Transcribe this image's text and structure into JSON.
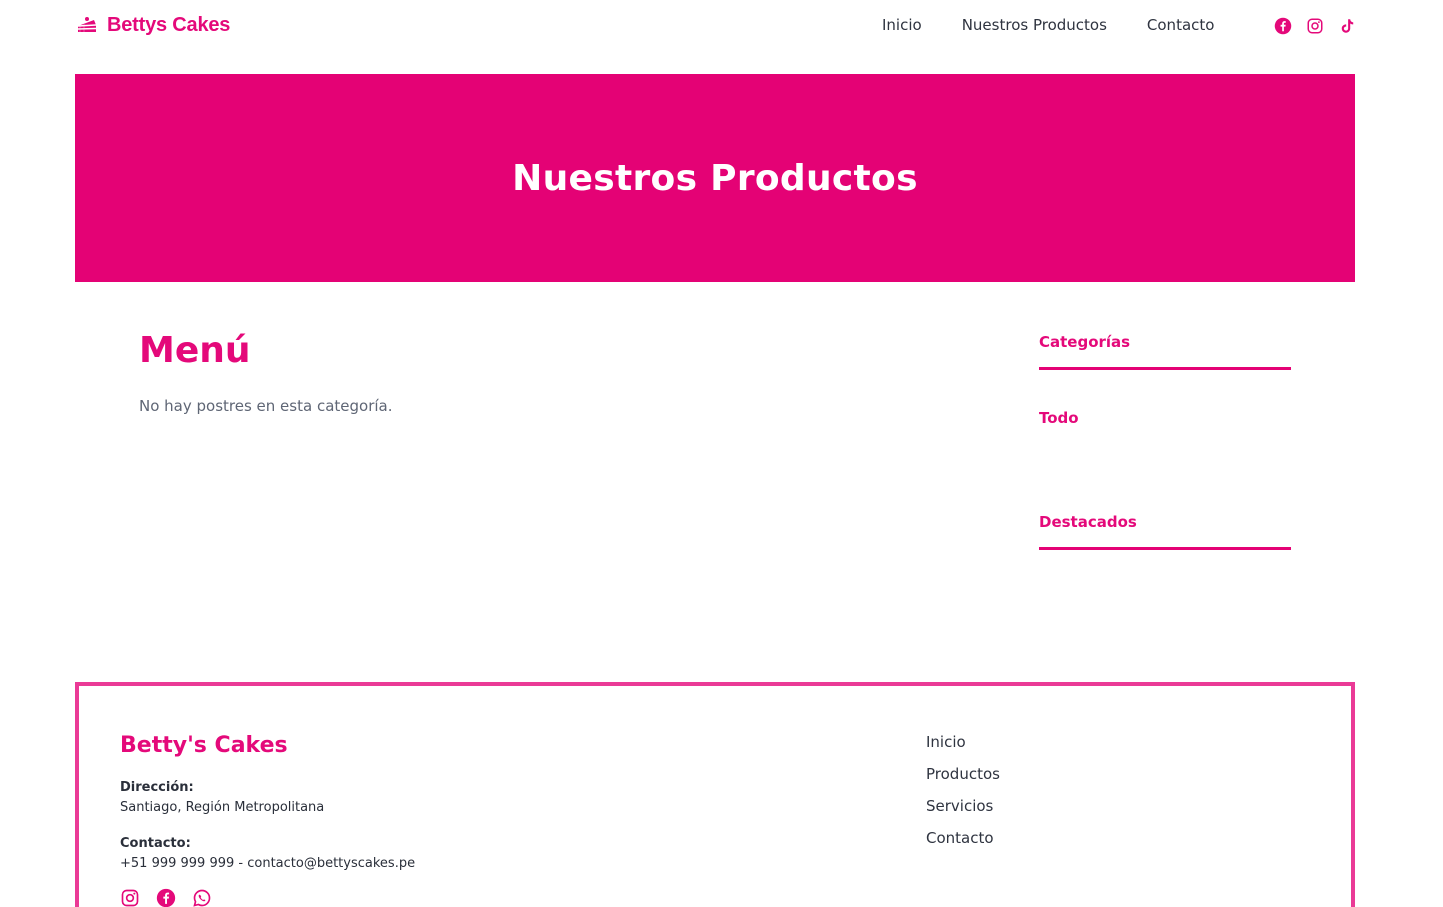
{
  "header": {
    "brand": "Bettys Cakes",
    "nav": [
      "Inicio",
      "Nuestros Productos",
      "Contacto"
    ],
    "social_icons": [
      "facebook-icon",
      "instagram-icon",
      "tiktok-icon"
    ]
  },
  "hero": {
    "title": "Nuestros Productos"
  },
  "main": {
    "heading": "Menú",
    "empty_message": "No hay postres en esta categoría."
  },
  "sidebar": {
    "categories_title": "Categorías",
    "categories": [
      "Todo"
    ],
    "featured_title": "Destacados"
  },
  "footer": {
    "brand": "Betty's Cakes",
    "address_label": "Dirección:",
    "address": "Santiago, Región Metropolitana",
    "contact_label": "Contacto:",
    "contact": "+51 999 999 999 - contacto@bettyscakes.pe",
    "links": [
      "Inicio",
      "Productos",
      "Servicios",
      "Contacto"
    ],
    "social_icons": [
      "instagram-icon",
      "facebook-icon",
      "whatsapp-icon"
    ]
  },
  "colors": {
    "brand": "#e4097a",
    "hero_bg": "#e40275",
    "footer_border": "#ea3a96",
    "text": "#2f3440"
  }
}
